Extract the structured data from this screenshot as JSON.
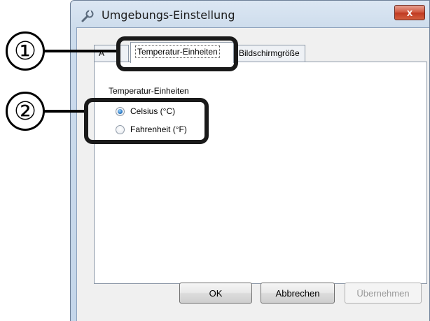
{
  "window": {
    "title": "Umgebungs-Einstellung",
    "close_label": "x"
  },
  "tabs": [
    {
      "label": "A",
      "active": false
    },
    {
      "label": "Temperatur-Einheiten",
      "active": true
    },
    {
      "label": "Bildschirmgröße",
      "active": false
    }
  ],
  "panel": {
    "group_label": "Temperatur-Einheiten",
    "options": [
      {
        "label": "Celsius (°C)",
        "checked": true
      },
      {
        "label": "Fahrenheit (°F)",
        "checked": false
      }
    ]
  },
  "buttons": {
    "ok": "OK",
    "cancel": "Abbrechen",
    "apply": "Übernehmen"
  },
  "annotations": {
    "marker_1": "①",
    "marker_2": "②"
  },
  "icons": {
    "title": "wrench-icon",
    "close": "close-icon"
  }
}
